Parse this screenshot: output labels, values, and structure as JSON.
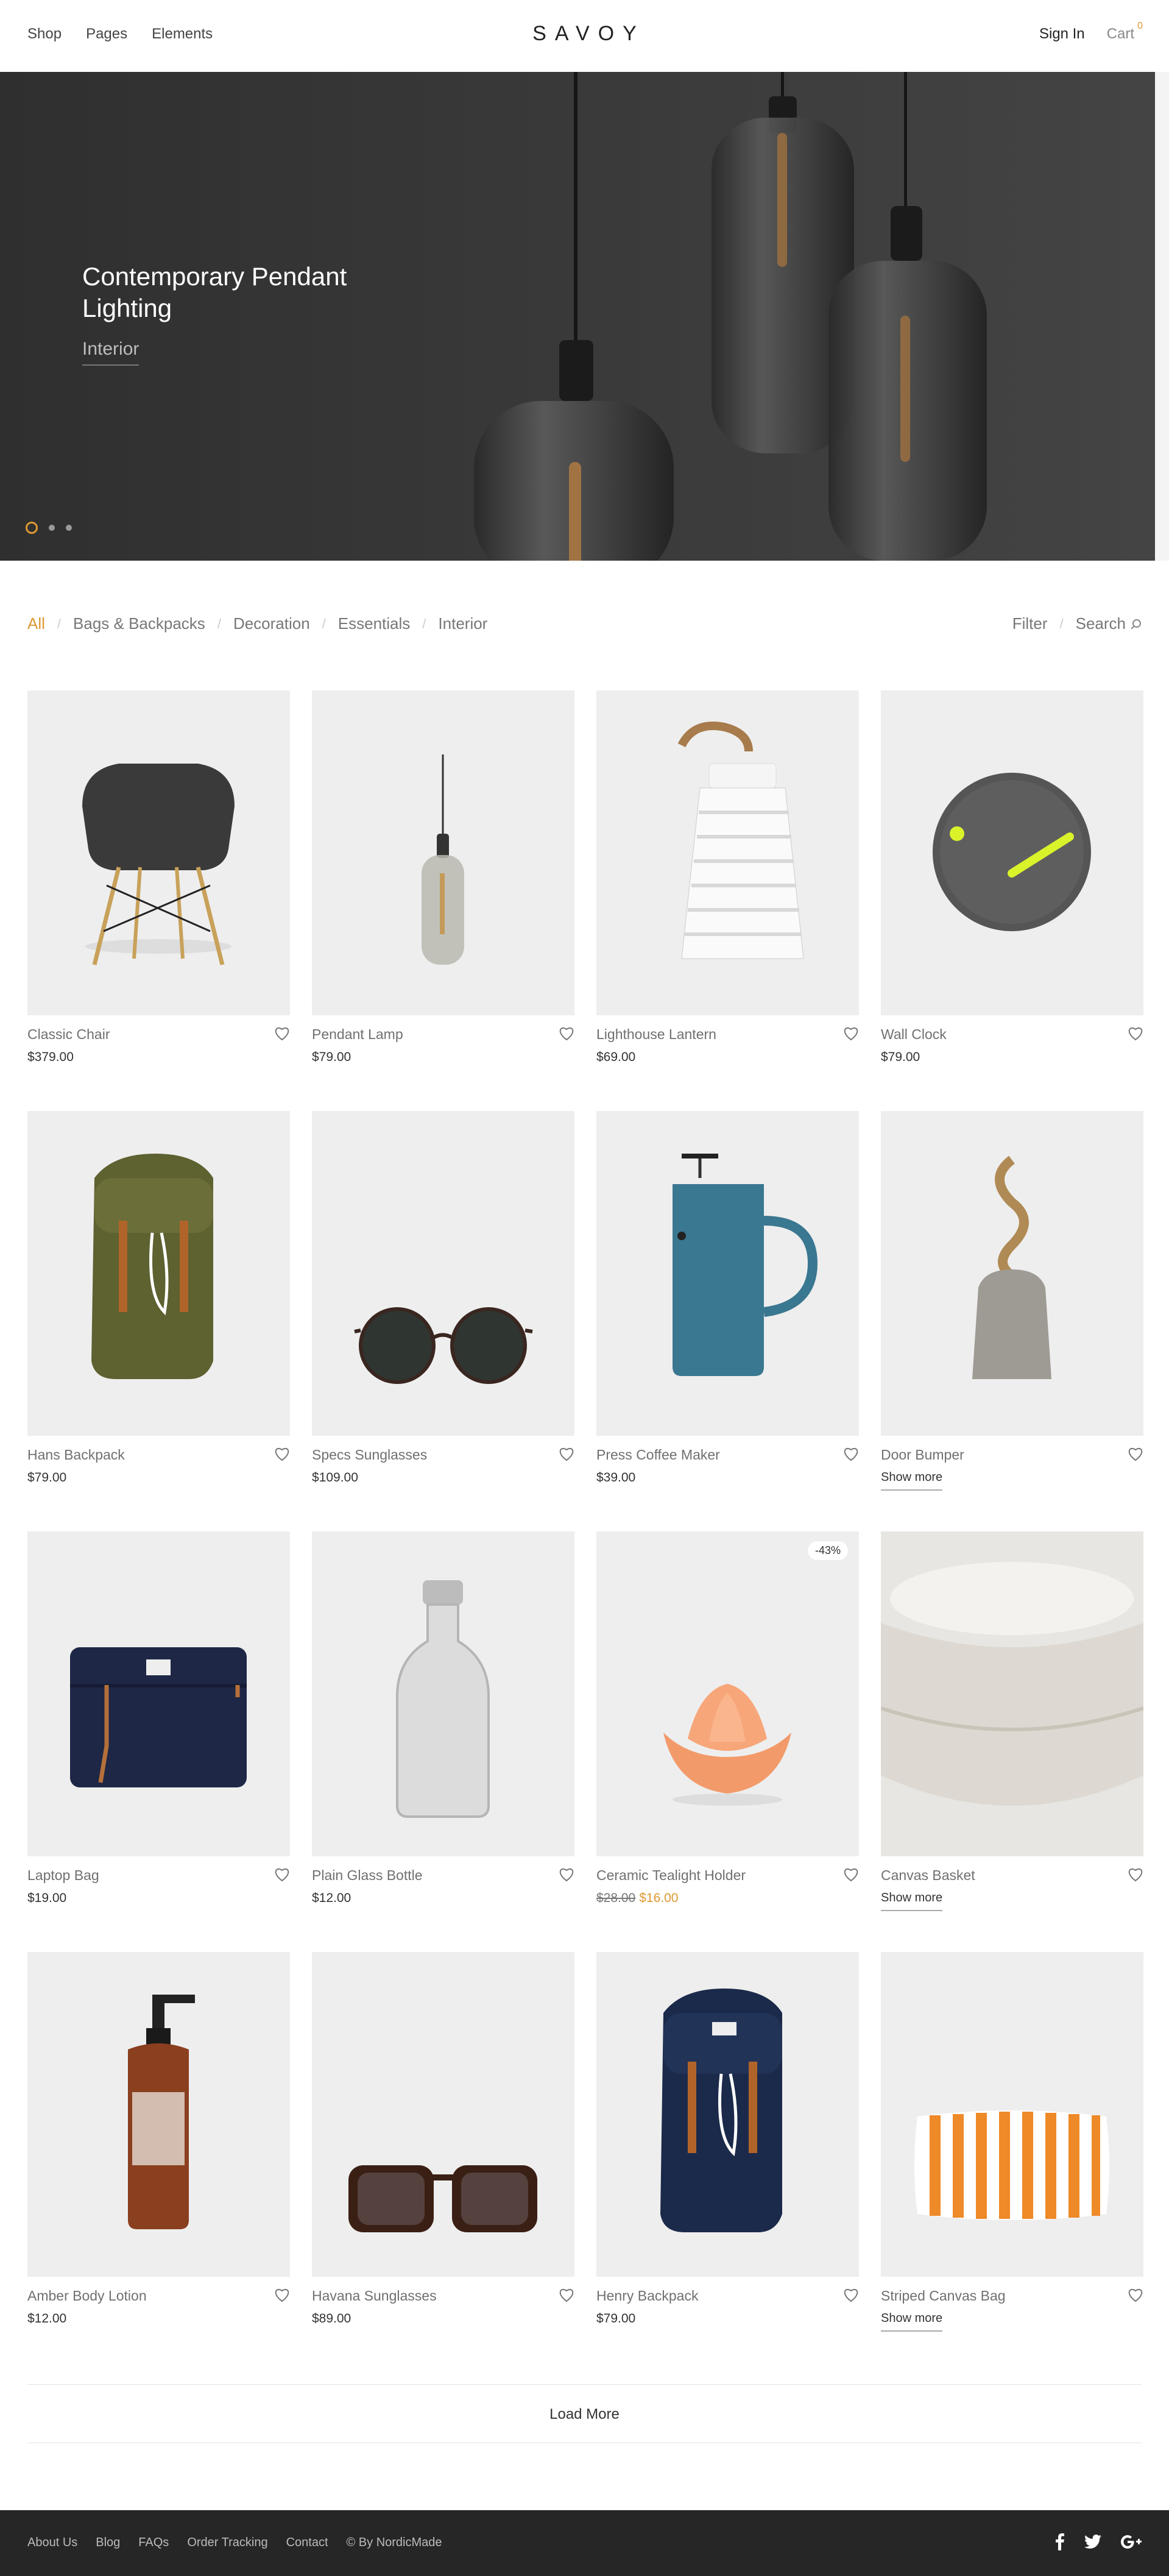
{
  "header": {
    "nav": [
      "Shop",
      "Pages",
      "Elements"
    ],
    "logo": "SAVOY",
    "sign_in": "Sign In",
    "cart_label": "Cart",
    "cart_count": "0"
  },
  "hero": {
    "title": "Contemporary Pendant Lighting",
    "category": "Interior",
    "slides": 3,
    "active_slide": 1
  },
  "filters": {
    "categories": [
      "All",
      "Bags & Backpacks",
      "Decoration",
      "Essentials",
      "Interior"
    ],
    "active": "All",
    "filter_label": "Filter",
    "search_label": "Search"
  },
  "products": [
    {
      "name": "Classic Chair",
      "price": "$379.00",
      "icon": "chair"
    },
    {
      "name": "Pendant Lamp",
      "price": "$79.00",
      "icon": "lamp"
    },
    {
      "name": "Lighthouse Lantern",
      "price": "$69.00",
      "icon": "lantern"
    },
    {
      "name": "Wall Clock",
      "price": "$79.00",
      "icon": "clock"
    },
    {
      "name": "Hans Backpack",
      "price": "$79.00",
      "icon": "backpack-green"
    },
    {
      "name": "Specs Sunglasses",
      "price": "$109.00",
      "icon": "sunglasses"
    },
    {
      "name": "Press Coffee Maker",
      "price": "$39.00",
      "icon": "coffee-maker"
    },
    {
      "name": "Door Bumper",
      "show_more": "Show more",
      "icon": "door-bumper"
    },
    {
      "name": "Laptop Bag",
      "price": "$19.00",
      "icon": "laptop-bag"
    },
    {
      "name": "Plain Glass Bottle",
      "price": "$12.00",
      "icon": "bottle"
    },
    {
      "name": "Ceramic Tealight Holder",
      "old_price": "$28.00",
      "sale_price": "$16.00",
      "badge": "-43%",
      "icon": "tealight"
    },
    {
      "name": "Canvas Basket",
      "show_more": "Show more",
      "icon": "basket"
    },
    {
      "name": "Amber Body Lotion",
      "price": "$12.00",
      "icon": "lotion"
    },
    {
      "name": "Havana Sunglasses",
      "price": "$89.00",
      "icon": "havana-sunglasses"
    },
    {
      "name": "Henry Backpack",
      "price": "$79.00",
      "icon": "backpack-navy"
    },
    {
      "name": "Striped Canvas Bag",
      "show_more": "Show more",
      "icon": "striped-bag"
    }
  ],
  "load_more": "Load More",
  "footer": {
    "links": [
      "About Us",
      "Blog",
      "FAQs",
      "Order Tracking",
      "Contact",
      "© By NordicMade"
    ],
    "social": [
      "facebook-icon",
      "twitter-icon",
      "google-plus-icon"
    ]
  },
  "colors": {
    "accent": "#dd9933",
    "hero_bg": "#3a3a3a",
    "product_bg": "#eeeeee",
    "footer_bg": "#262626"
  }
}
